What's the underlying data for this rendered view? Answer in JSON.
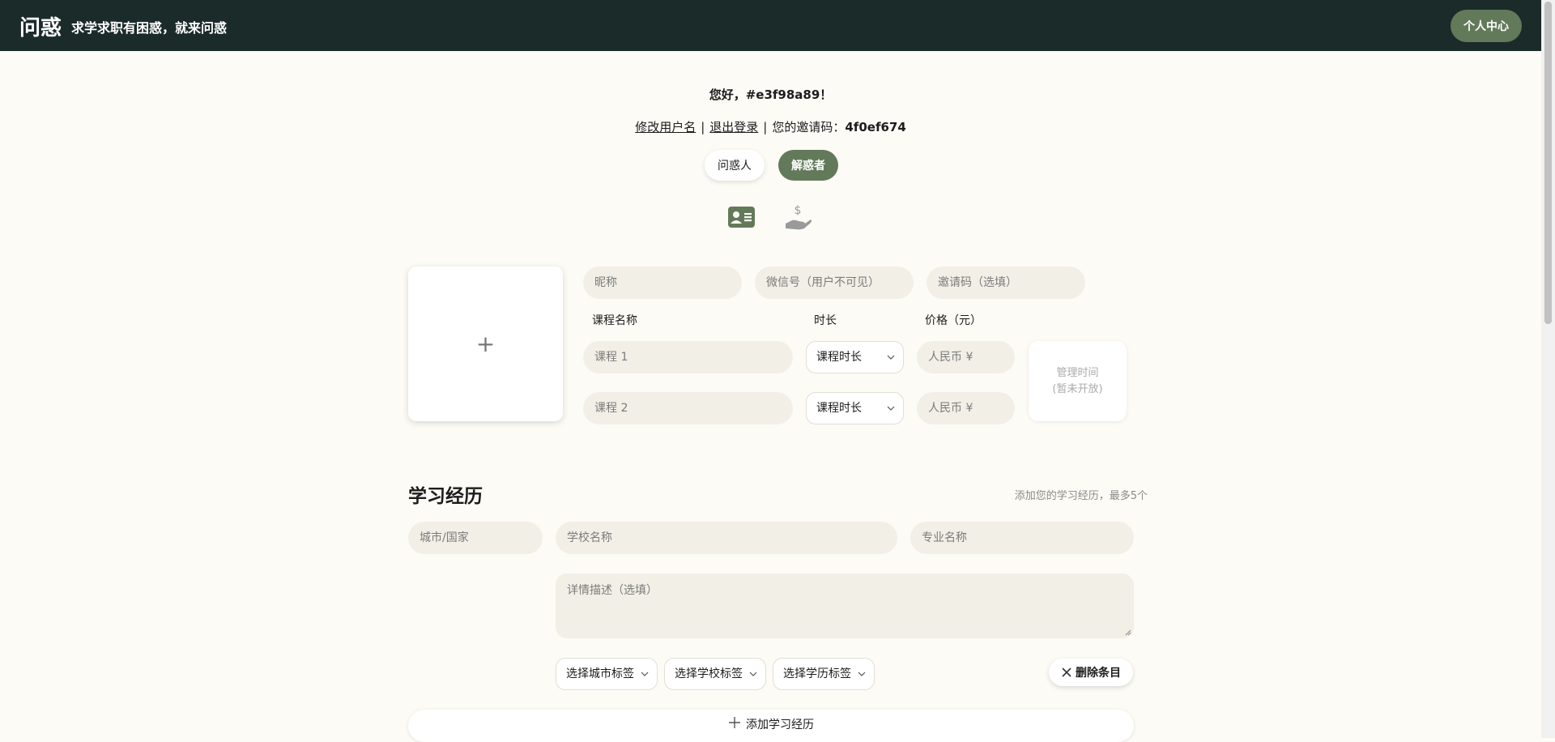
{
  "header": {
    "brand": "问惑",
    "slogan": "求学求职有困惑，就来问惑",
    "user_center_label": "个人中心"
  },
  "profile": {
    "greeting": "您好，#e3f98a89！",
    "edit_username_label": "修改用户名",
    "logout_label": "退出登录",
    "invite_prefix": "您的邀请码：",
    "invite_code": "4f0ef674",
    "separator": "|"
  },
  "roles": {
    "asker_label": "问惑人",
    "solver_label": "解惑者",
    "active": "解惑者"
  },
  "icons": {
    "first": "id-card-icon",
    "second": "hand-dollar-icon",
    "active_color": "#637a5a"
  },
  "form": {
    "avatar_symbol": "+",
    "nickname_placeholder": "昵称",
    "wechat_placeholder": "微信号（用户不可见）",
    "invite_placeholder": "邀请码（选填）",
    "course_name_label": "课程名称",
    "duration_label": "时长",
    "price_label": "价格（元）",
    "courses": [
      {
        "name_placeholder": "课程 1",
        "duration": "课程时长",
        "price_placeholder": "人民币 ¥"
      },
      {
        "name_placeholder": "课程 2",
        "duration": "课程时长",
        "price_placeholder": "人民币 ¥"
      }
    ],
    "manage_line1": "管理时间",
    "manage_line2": "(暂未开放)"
  },
  "education": {
    "title": "学习经历",
    "hint": "添加您的学习经历，最多5个",
    "city_placeholder": "城市/国家",
    "school_placeholder": "学校名称",
    "major_placeholder": "专业名称",
    "detail_placeholder": "详情描述（选填）",
    "city_tag": "选择城市标签",
    "school_tag": "选择学校标签",
    "degree_tag": "选择学历标签",
    "delete_label": "删除条目",
    "add_label": "添加学习经历"
  },
  "colors": {
    "topbar": "#1b2b2a",
    "accent": "#637a5a",
    "background": "#fcfbf5",
    "field": "#f1efe6"
  }
}
